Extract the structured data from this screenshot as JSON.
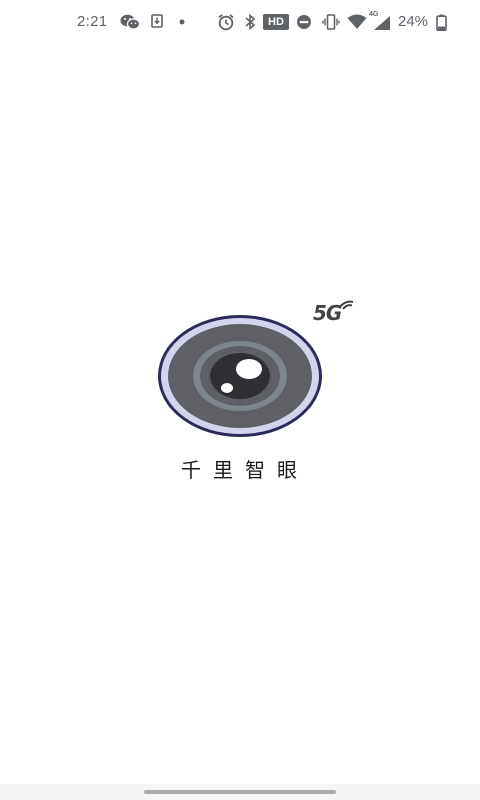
{
  "status_bar": {
    "time": "2:21",
    "hd_label": "HD",
    "network_label": "4G",
    "battery_percent": "24%",
    "battery_level": 0.24,
    "icons": [
      "wechat-icon",
      "download-notification-icon",
      "dot-icon",
      "alarm-icon",
      "bluetooth-icon",
      "hd-icon",
      "do-not-disturb-icon",
      "vibrate-icon",
      "wifi-icon",
      "signal-icon",
      "battery-icon"
    ]
  },
  "splash": {
    "logo_badge": "5G",
    "app_name": "千里智眼"
  },
  "colors": {
    "status_icon": "#5f6368",
    "lens_outer": "#2b2b59",
    "lens_ring": "#d3d3ec",
    "lens_body": "#5f5f66",
    "lens_inner_ring": "#7d868c",
    "pupil": "#2e2e33",
    "badge": "#444444"
  }
}
